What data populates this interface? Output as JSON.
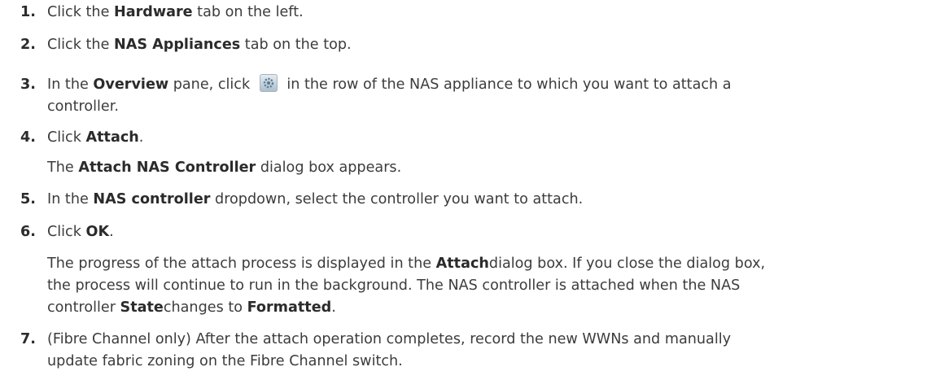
{
  "steps": [
    {
      "num": "1.",
      "pre": "Click the ",
      "b1": "Hardware",
      "post": " tab on the left."
    },
    {
      "num": "2.",
      "pre": "Click the ",
      "b1": "NAS Appliances",
      "post": " tab on the top."
    },
    {
      "num": "3.",
      "pre": "In the ",
      "b1": "Overview",
      "mid": " pane, click ",
      "post": " in the row of the NAS appliance to which you want to attach a",
      "cont": "controller.",
      "icon": "gear-icon"
    },
    {
      "num": "4.",
      "pre": "Click ",
      "b1": "Attach",
      "post": ".",
      "sub_pre": "The ",
      "sub_b": "Attach NAS Controller",
      "sub_post": " dialog box appears."
    },
    {
      "num": "5.",
      "pre": "In the ",
      "b1": "NAS controller",
      "post": " dropdown, select the controller you want to attach."
    },
    {
      "num": "6.",
      "pre": "Click ",
      "b1": "OK",
      "post": ".",
      "p1a": "The progress of the attach process is displayed in the ",
      "p1b": "Attach",
      "p1c": "dialog box. If you close the dialog box,",
      "p2": "the process will continue to run in the background. The NAS controller is attached when the NAS",
      "p3a": "controller ",
      "p3b": "State",
      "p3c": "changes to ",
      "p3d": "Formatted",
      "p3e": "."
    },
    {
      "num": "7.",
      "l1": "(Fibre Channel only) After the attach operation completes, record the new WWNs and manually",
      "l2": "update fabric zoning on the Fibre Channel switch."
    }
  ]
}
